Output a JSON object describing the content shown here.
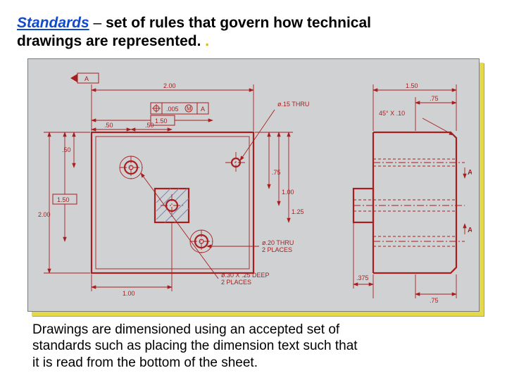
{
  "heading": {
    "term": "Standards",
    "dash": " – ",
    "rest_line1": "set of rules that govern how technical",
    "rest_line2": "drawings are represented.",
    "dot": " ."
  },
  "drawing": {
    "datum_label": "A",
    "gdt_value": ".005",
    "gdt_mod": "M",
    "gdt_ref": "A",
    "front": {
      "width_overall": "2.00",
      "box_1_50": "1.50",
      "dim_50_a": ".50",
      "dim_50_b": ".50",
      "dim_50_c": ".50",
      "basic_1_50": "1.50",
      "height_2_00": "2.00",
      "bottom_1_00": "1.00",
      "right_75": ".75",
      "right_1_00": "1.00",
      "right_1_25": "1.25"
    },
    "side": {
      "top_1_50": "1.50",
      "top_75": ".75",
      "chamfer": "45° X .10",
      "sectA_1": "A",
      "sectA_2": "A",
      "bottom_375": ".375",
      "bottom_75": ".75"
    },
    "notes": {
      "hole15": "ø.15 THRU",
      "hole20_l1": "ø.20 THRU",
      "hole20_l2": "2 PLACES",
      "cbore_l1": "ø.30 X .25 DEEP",
      "cbore_l2": "2 PLACES"
    }
  },
  "caption": {
    "l1": "Drawings are dimensioned using an accepted set of",
    "l2": "standards such as placing the dimension text such that",
    "l3": "it is read from the bottom of the sheet."
  }
}
